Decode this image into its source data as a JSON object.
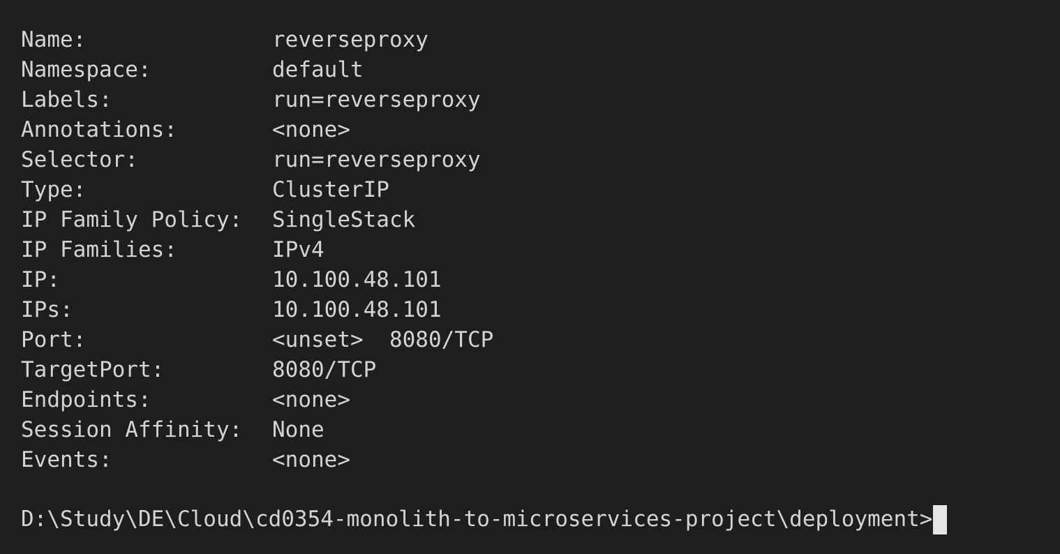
{
  "terminal": {
    "rows": [
      {
        "key": "Name:",
        "value": "reverseproxy"
      },
      {
        "key": "Namespace:",
        "value": "default"
      },
      {
        "key": "Labels:",
        "value": "run=reverseproxy"
      },
      {
        "key": "Annotations:",
        "value": "<none>"
      },
      {
        "key": "Selector:",
        "value": "run=reverseproxy"
      },
      {
        "key": "Type:",
        "value": "ClusterIP"
      },
      {
        "key": "IP Family Policy:",
        "value": "SingleStack"
      },
      {
        "key": "IP Families:",
        "value": "IPv4"
      },
      {
        "key": "IP:",
        "value": "10.100.48.101"
      },
      {
        "key": "IPs:",
        "value": "10.100.48.101"
      },
      {
        "key": "Port:",
        "value": "<unset>  8080/TCP"
      },
      {
        "key": "TargetPort:",
        "value": "8080/TCP"
      },
      {
        "key": "Endpoints:",
        "value": "<none>"
      },
      {
        "key": "Session Affinity:",
        "value": "None"
      },
      {
        "key": "Events:",
        "value": "<none>"
      }
    ],
    "prompt": "D:\\Study\\DE\\Cloud\\cd0354-monolith-to-microservices-project\\deployment>"
  }
}
